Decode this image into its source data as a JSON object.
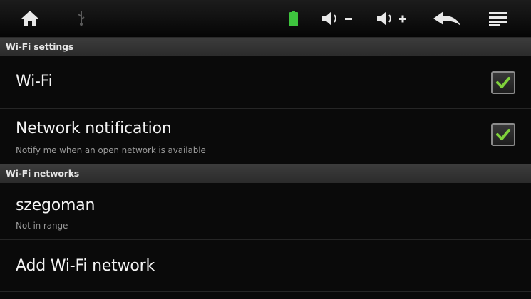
{
  "statusbar": {
    "icons": [
      "home-icon",
      "usb-icon",
      "battery-icon",
      "volume-down-icon",
      "volume-up-icon",
      "back-icon",
      "menu-icon"
    ]
  },
  "colors": {
    "background": "#0a0a0a",
    "section_header": "#333333",
    "check_mark": "#7fd13b",
    "battery": "#3ec43e"
  },
  "sections": {
    "wifi_settings": {
      "header": "Wi-Fi settings",
      "wifi": {
        "title": "Wi-Fi",
        "checked": true
      },
      "network_notification": {
        "title": "Network notification",
        "subtitle": "Notify me when an open network is available",
        "checked": true
      }
    },
    "wifi_networks": {
      "header": "Wi-Fi networks",
      "network": {
        "title": "szegoman",
        "subtitle": "Not in range"
      },
      "add_network": {
        "title": "Add Wi-Fi network"
      }
    }
  }
}
